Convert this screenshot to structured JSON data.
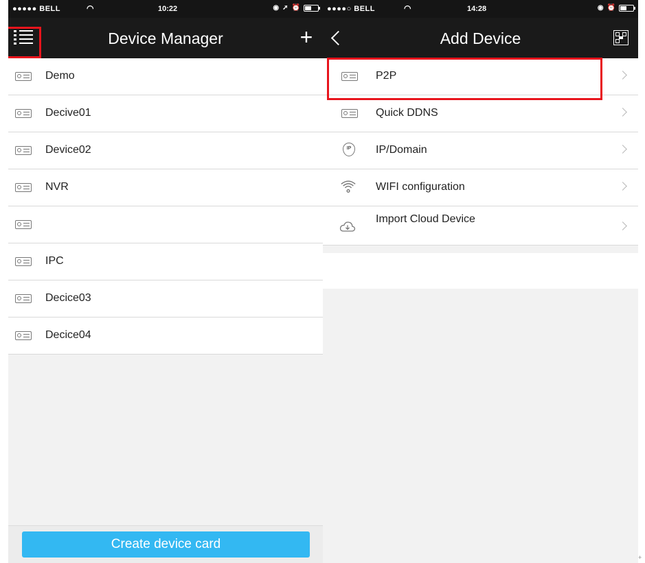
{
  "left": {
    "status": {
      "carrier": "●●●●● BELL",
      "time": "10:22"
    },
    "title": "Device Manager",
    "devices": [
      {
        "label": "Demo"
      },
      {
        "label": "Decive01"
      },
      {
        "label": "Device02"
      },
      {
        "label": "NVR"
      },
      {
        "label": ""
      },
      {
        "label": "IPC"
      },
      {
        "label": "Decice03"
      },
      {
        "label": "Decice04"
      }
    ],
    "create_button": "Create device card"
  },
  "right": {
    "status": {
      "carrier": "●●●●○ BELL",
      "time": "14:28"
    },
    "title": "Add Device",
    "options": [
      {
        "label": "P2P",
        "icon": "device-icon"
      },
      {
        "label": "Quick DDNS",
        "icon": "device-icon"
      },
      {
        "label": "IP/Domain",
        "icon": "ip-pin-icon",
        "icon_text": "IP"
      },
      {
        "label": "WIFI configuration",
        "icon": "wifi-icon"
      },
      {
        "label": "Import Cloud Device",
        "icon": "cloud-download-icon"
      }
    ]
  },
  "colors": {
    "header_bg": "#1a1a1a",
    "highlight": "#e8141c",
    "button_blue": "#33b8f2",
    "background": "#f2f2f2"
  }
}
